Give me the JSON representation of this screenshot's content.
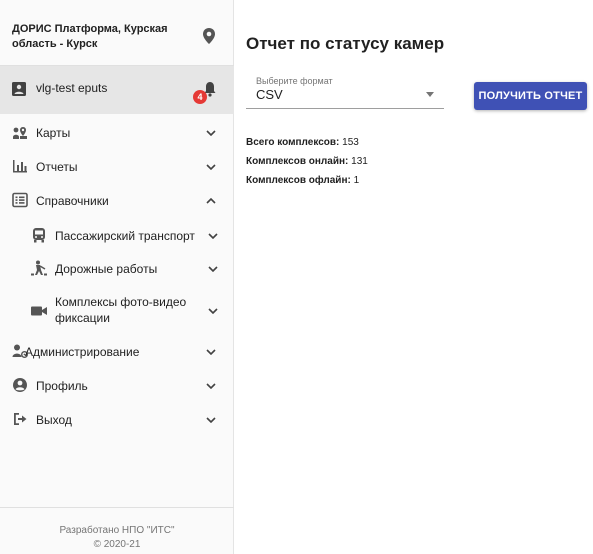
{
  "sidebar": {
    "org_name": "ДОРИС Платформа, Курская область - Курск",
    "user": {
      "name": "vlg-test eputs",
      "notifications": "4"
    },
    "nav": {
      "maps": "Карты",
      "reports": "Отчеты",
      "references": "Справочники",
      "passenger_transport": "Пассажирский транспорт",
      "road_works": "Дорожные работы",
      "photo_video_line1": "Комплексы фото-видео",
      "photo_video_line2": "фиксации",
      "admin": "Администрирование",
      "profile": "Профиль",
      "logout": "Выход"
    },
    "footer": {
      "line1": "Разработано НПО \"ИТС\"",
      "line2": "© 2020-21"
    }
  },
  "main": {
    "title": "Отчет по статусу камер",
    "format_select": {
      "label": "Выберите формат",
      "value": "CSV"
    },
    "get_report_button": "ПОЛУЧИТЬ ОТЧЕТ",
    "stats": [
      {
        "label": "Всего комплексов:",
        "value": "153"
      },
      {
        "label": "Комплексов онлайн:",
        "value": "131"
      },
      {
        "label": "Комплексов офлайн:",
        "value": "1"
      }
    ]
  },
  "colors": {
    "accent": "#3f51b5",
    "badge": "#e53935",
    "icon": "#555555"
  }
}
